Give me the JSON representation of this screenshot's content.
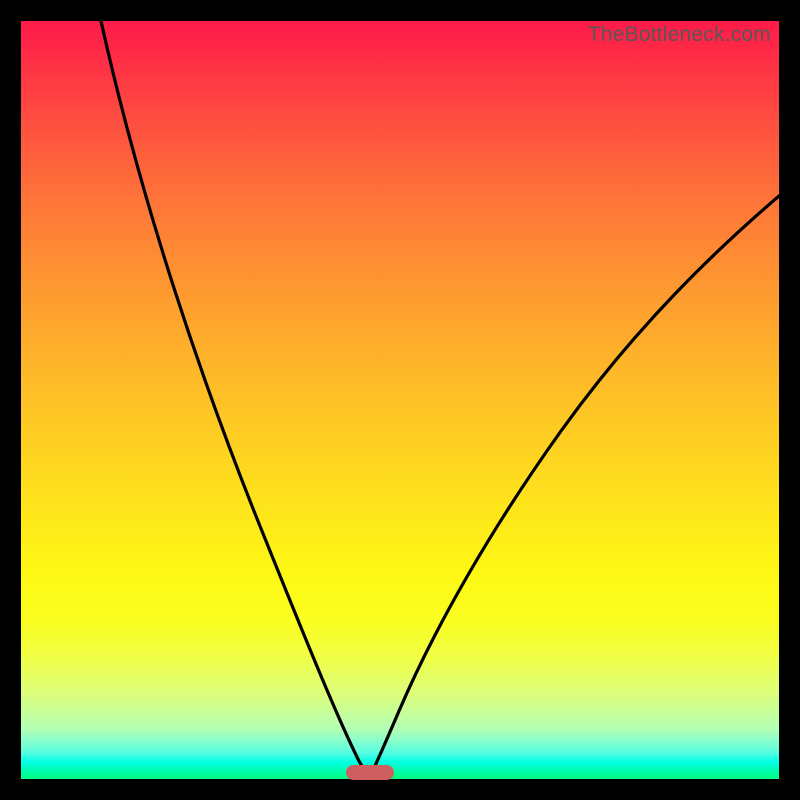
{
  "watermark": "TheBottleneck.com",
  "colors": {
    "page_bg": "#000000",
    "marker": "#ce5f60",
    "curve": "#000000"
  },
  "chart_data": {
    "type": "line",
    "title": "",
    "xlabel": "",
    "ylabel": "",
    "xlim": [
      0,
      100
    ],
    "ylim": [
      0,
      100
    ],
    "marker": {
      "x_center": 46,
      "width": 6.3,
      "y": 0
    },
    "series": [
      {
        "name": "left-curve",
        "x": [
          10.5,
          14.0,
          17.5,
          21.0,
          24.5,
          28.0,
          31.5,
          35.0,
          38.5,
          42.0,
          44.5,
          46.0
        ],
        "y": [
          100.0,
          88.0,
          75.0,
          62.5,
          51.0,
          40.5,
          31.0,
          22.5,
          15.0,
          8.5,
          3.5,
          0.5
        ]
      },
      {
        "name": "right-curve",
        "x": [
          46.0,
          48.0,
          51.0,
          55.0,
          60.0,
          66.0,
          73.0,
          81.0,
          90.0,
          100.0
        ],
        "y": [
          0.5,
          4.0,
          11.0,
          21.0,
          32.0,
          43.0,
          53.0,
          62.0,
          70.0,
          77.0
        ]
      }
    ],
    "gradient_stops": [
      {
        "pos": 0.0,
        "color": "#fe1a49"
      },
      {
        "pos": 0.1,
        "color": "#fe4242"
      },
      {
        "pos": 0.22,
        "color": "#fe6f3a"
      },
      {
        "pos": 0.34,
        "color": "#fe9531"
      },
      {
        "pos": 0.46,
        "color": "#feb729"
      },
      {
        "pos": 0.57,
        "color": "#fed321"
      },
      {
        "pos": 0.66,
        "color": "#fee91a"
      },
      {
        "pos": 0.73,
        "color": "#fdf814"
      },
      {
        "pos": 0.79,
        "color": "#fbfe20"
      },
      {
        "pos": 0.84,
        "color": "#f0fe46"
      },
      {
        "pos": 0.89,
        "color": "#dafe7e"
      },
      {
        "pos": 0.935,
        "color": "#b2feb6"
      },
      {
        "pos": 0.965,
        "color": "#58fee2"
      },
      {
        "pos": 0.978,
        "color": "#00fee1"
      },
      {
        "pos": 1.0,
        "color": "#00fe7c"
      }
    ]
  }
}
